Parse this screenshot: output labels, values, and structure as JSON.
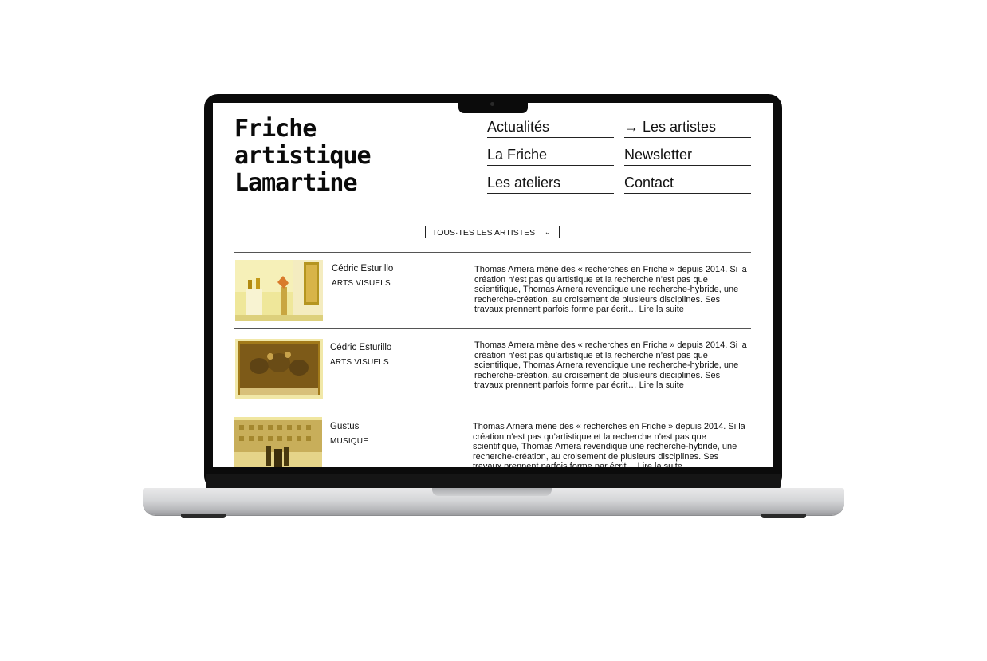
{
  "logo": {
    "lines": [
      "Friche",
      "artistique",
      "Lamartine"
    ]
  },
  "nav": {
    "items": [
      {
        "label": "Actualités"
      },
      {
        "label": "Les artistes",
        "arrow": "→"
      },
      {
        "label": "La Friche"
      },
      {
        "label": "Newsletter"
      },
      {
        "label": "Les ateliers"
      },
      {
        "label": "Contact"
      }
    ]
  },
  "filter": {
    "selected": "TOUS·TES LES ARTISTES",
    "icon": "chevron-down-icon"
  },
  "artists": [
    {
      "name": "Cédric Esturillo",
      "category": "ARTS VISUELS",
      "bio": "Thomas Arnera mène des « recherches en Friche » depuis 2014. Si la création n’est pas qu’artistique et la recherche n’est pas que scientifique, Thomas Arnera revendique une recherche-hybride, une recherche-création, au croisement de plusieurs disciplines. Ses travaux prennent parfois forme par écrit… Lire la suite"
    },
    {
      "name": "Cédric Esturillo",
      "category": "ARTS VISUELS",
      "bio": "Thomas Arnera mène des « recherches en Friche » depuis 2014. Si la création n’est pas qu’artistique et la recherche n’est pas que scientifique, Thomas Arnera revendique une recherche-hybride, une recherche-création, au croisement de plusieurs disciplines. Ses travaux prennent parfois forme par écrit… Lire la suite"
    },
    {
      "name": "Gustus",
      "category": "MUSIQUE",
      "bio": "Thomas Arnera mène des « recherches en Friche » depuis 2014. Si la création n’est pas qu’artistique et la recherche n’est pas que scientifique, Thomas Arnera revendique une recherche-hybride, une recherche-création, au croisement de plusieurs disciplines. Ses travaux prennent parfois forme par écrit… Lire la suite"
    }
  ],
  "colors": {
    "thumb_tint": "#f2e66a",
    "text": "#111111",
    "bezel": "#0b0b0b"
  }
}
